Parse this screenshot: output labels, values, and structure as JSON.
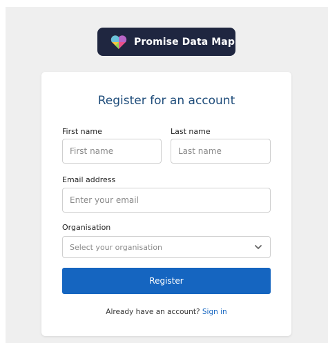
{
  "logo": {
    "text": "Promise Data Map"
  },
  "form": {
    "title": "Register for an account",
    "first_name": {
      "label": "First name",
      "placeholder": "First name",
      "value": ""
    },
    "last_name": {
      "label": "Last name",
      "placeholder": "Last name",
      "value": ""
    },
    "email": {
      "label": "Email address",
      "placeholder": "Enter your email",
      "value": ""
    },
    "organisation": {
      "label": "Organisation",
      "selected": "Select your organisation"
    },
    "submit_label": "Register",
    "signin_prompt": "Already have an account?",
    "signin_link": "Sign in"
  },
  "colors": {
    "accent": "#1565c0",
    "title": "#1e4c7a",
    "logo_bg": "#1f2640",
    "page_bg": "#efefef"
  }
}
